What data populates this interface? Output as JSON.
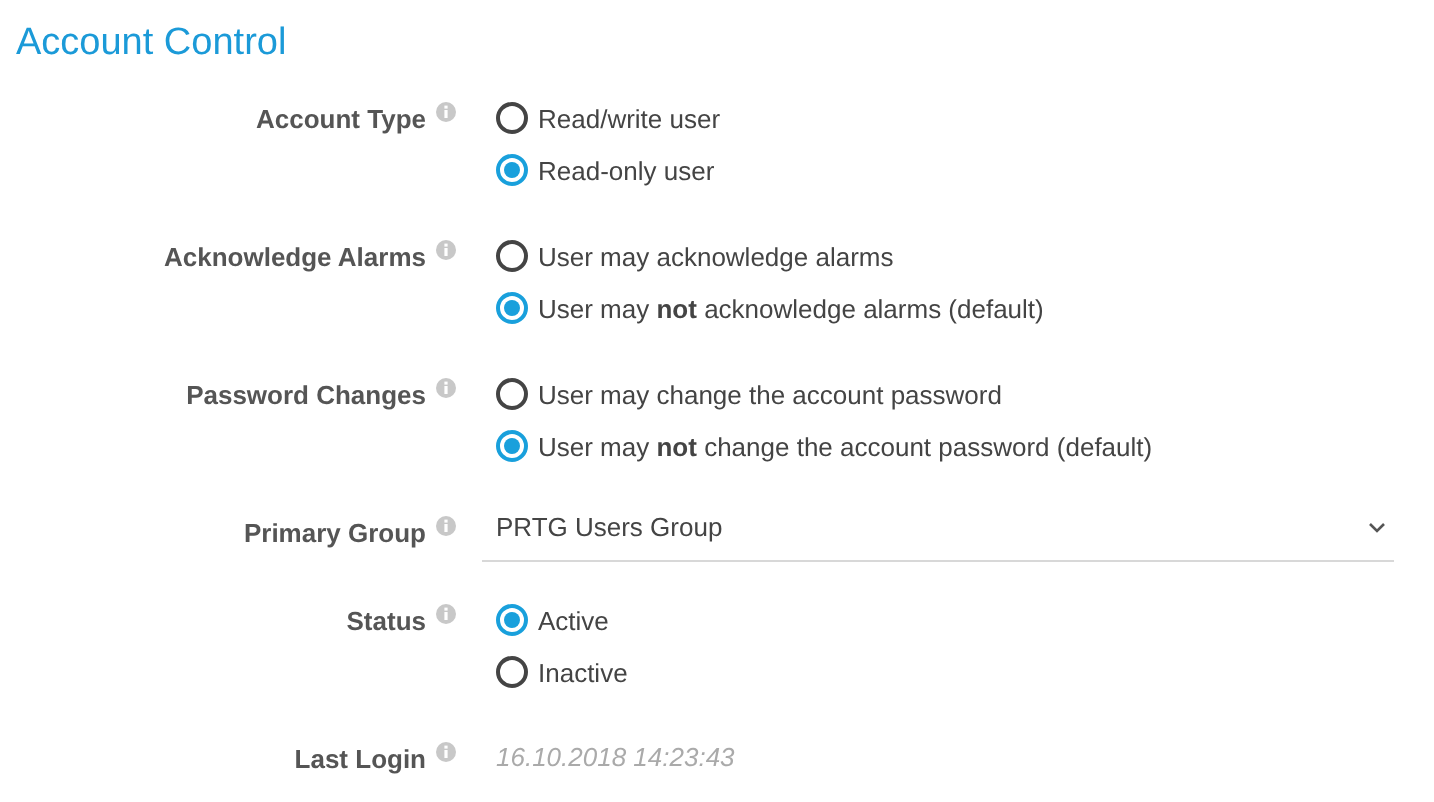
{
  "title": "Account Control",
  "fields": [
    {
      "kind": "radio",
      "label": "Account Type",
      "options": [
        {
          "text": "Read/write user",
          "selected": false
        },
        {
          "text": "Read-only user",
          "selected": true
        }
      ]
    },
    {
      "kind": "radio",
      "label": "Acknowledge Alarms",
      "options": [
        {
          "text": "User may acknowledge alarms",
          "selected": false
        },
        {
          "text": "User may **not** acknowledge alarms (default)",
          "selected": true
        }
      ]
    },
    {
      "kind": "radio",
      "label": "Password Changes",
      "options": [
        {
          "text": "User may change the account password",
          "selected": false
        },
        {
          "text": "User may **not** change the account password (default)",
          "selected": true
        }
      ]
    },
    {
      "kind": "select",
      "label": "Primary Group",
      "value": "PRTG Users Group"
    },
    {
      "kind": "radio",
      "label": "Status",
      "options": [
        {
          "text": "Active",
          "selected": true
        },
        {
          "text": "Inactive",
          "selected": false
        }
      ]
    },
    {
      "kind": "text",
      "label": "Last Login",
      "value": "16.10.2018 14:23:43"
    }
  ]
}
